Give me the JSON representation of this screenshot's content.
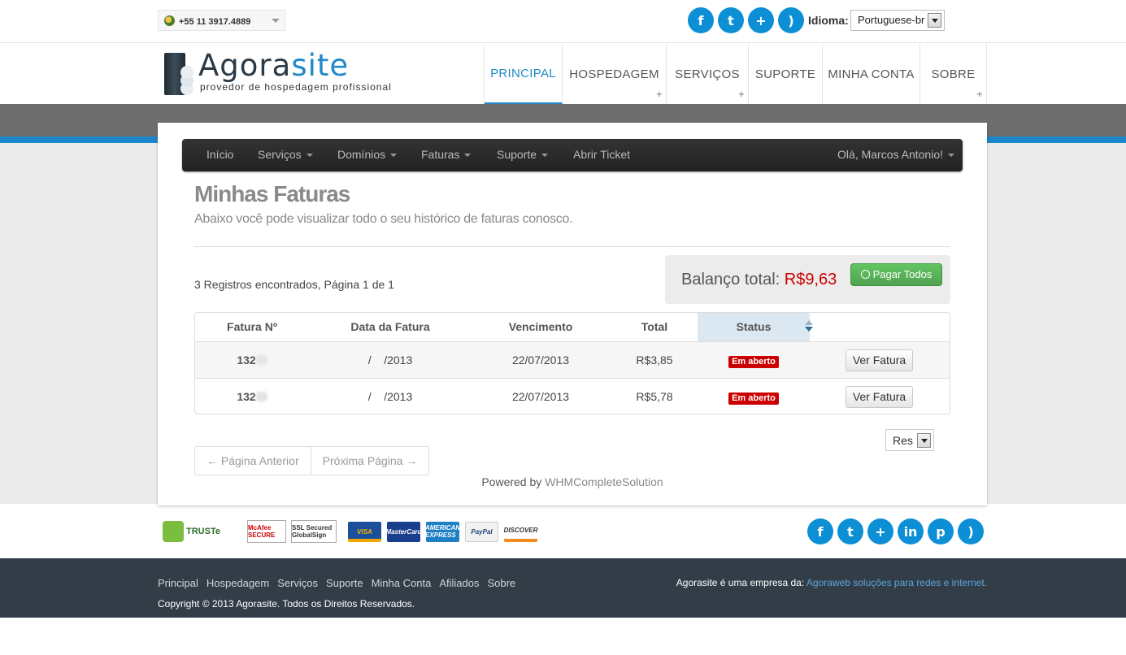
{
  "topbar": {
    "phone": "+55 11 3917.4889",
    "language_label": "Idioma:",
    "language_value": "Portuguese-br",
    "social_icons": [
      "facebook-icon",
      "twitter-icon",
      "plus-icon",
      "rss-icon"
    ]
  },
  "header": {
    "logo_name_part1": "Agora",
    "logo_name_part2": "site",
    "logo_tagline": "provedor de hospedagem profissional",
    "nav": [
      {
        "label": "PRINCIPAL",
        "active": true,
        "has_sub": false
      },
      {
        "label": "HOSPEDAGEM",
        "active": false,
        "has_sub": true
      },
      {
        "label": "SERVIÇOS",
        "active": false,
        "has_sub": true
      },
      {
        "label": "SUPORTE",
        "active": false,
        "has_sub": false
      },
      {
        "label": "MINHA CONTA",
        "active": false,
        "has_sub": false
      },
      {
        "label": "SOBRE",
        "active": false,
        "has_sub": true
      }
    ]
  },
  "client_nav": {
    "items": [
      "Início",
      "Serviços",
      "Domínios",
      "Faturas",
      "Suporte",
      "Abrir Ticket"
    ],
    "user": "Olá, Marcos Antonio!"
  },
  "page": {
    "title": "Minhas Faturas",
    "subtitle": "Abaixo você pode visualizar todo o seu histórico de faturas conosco.",
    "records_info": "3 Registros encontrados, Página 1 de 1",
    "balance_label": "Balanço total:",
    "balance_value": "R$9,63",
    "pay_all": "Pagar Todos"
  },
  "table": {
    "headers": [
      "Fatura Nº",
      "Data da Fatura",
      "Vencimento",
      "Total",
      "Status"
    ],
    "rows": [
      {
        "number": "132",
        "date_sep": "/",
        "date_year": "/2013",
        "due": "22/07/2013",
        "total": "R$3,85",
        "status": "Em aberto",
        "action": "Ver Fatura"
      },
      {
        "number": "132",
        "date_sep": "/",
        "date_year": "/2013",
        "due": "22/07/2013",
        "total": "R$5,78",
        "status": "Em aberto",
        "action": "Ver Fatura"
      }
    ]
  },
  "pagination": {
    "results_select": "Res",
    "prev": "← Página Anterior",
    "next": "Próxima Página →"
  },
  "powered": {
    "prefix": "Powered by",
    "link": "WHMCompleteSolution"
  },
  "trust_badges": {
    "truste": "TRUSTe",
    "mcafee": "McAfee SECURE",
    "globalsign": "SSL Secured GlobalSign",
    "cards": [
      "VISA",
      "MasterCard",
      "AMERICAN EXPRESS",
      "PayPal",
      "DISCOVER"
    ]
  },
  "footer": {
    "nav": [
      "Principal",
      "Hospedagem",
      "Serviços",
      "Suporte",
      "Minha Conta",
      "Afiliados",
      "Sobre"
    ],
    "copyright": "Copyright © 2013 Agorasite. Todos os Direitos Reservados.",
    "company_label": "Agorasite é uma empresa da:",
    "company_link": "Agoraweb soluções para redes e internet.",
    "social_icons": [
      "facebook-icon",
      "twitter-icon",
      "plus-icon",
      "linkedin-icon",
      "pinterest-icon",
      "rss-icon"
    ]
  },
  "colors": {
    "brand_blue": "#1f89c9",
    "status_red": "#cc0000",
    "pay_green": "#51a351",
    "footer_bg": "#323d48"
  }
}
